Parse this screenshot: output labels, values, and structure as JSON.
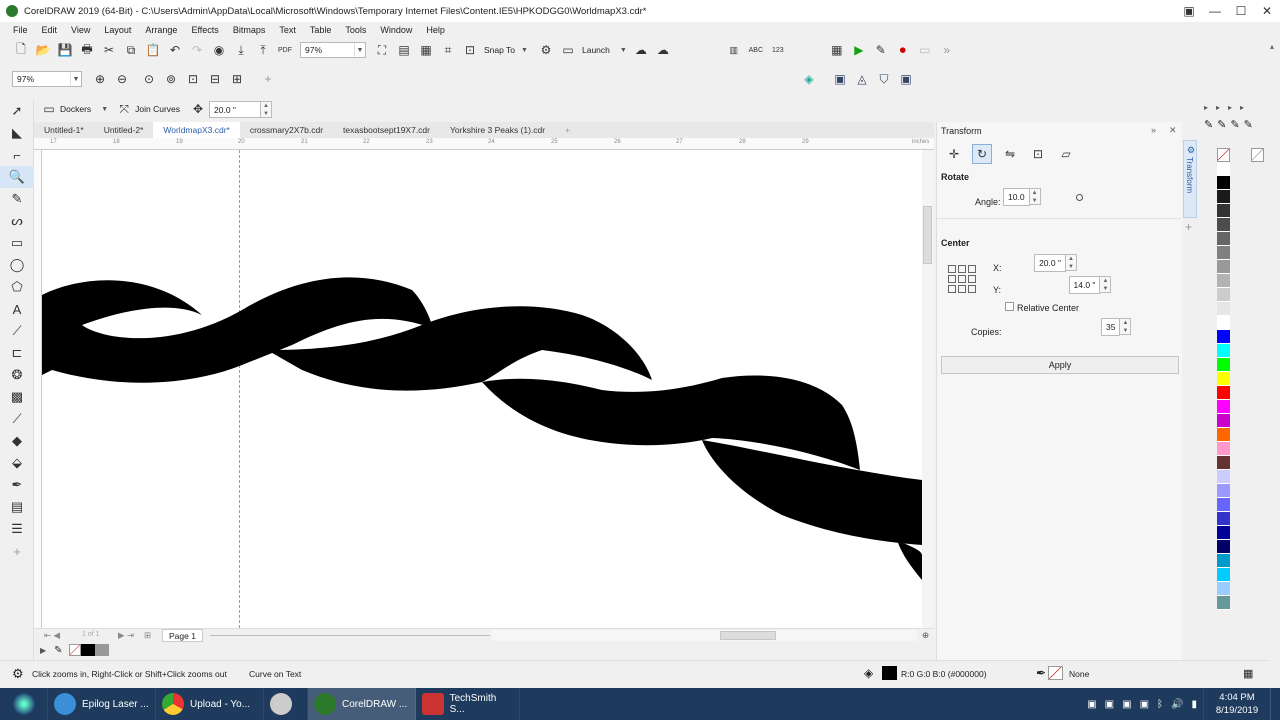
{
  "window": {
    "title": "CorelDRAW 2019 (64-Bit) - C:\\Users\\Admin\\AppData\\Local\\Microsoft\\Windows\\Temporary Internet Files\\Content.IE5\\HPKODGG0\\WorldmapX3.cdr*",
    "minimize": "—",
    "maximize": "☐",
    "close": "✕"
  },
  "menu": [
    "File",
    "Edit",
    "View",
    "Layout",
    "Arrange",
    "Effects",
    "Bitmaps",
    "Text",
    "Table",
    "Tools",
    "Window",
    "Help"
  ],
  "toolbar": {
    "zoom": "97%",
    "snap_to": "Snap To",
    "launch": "Launch"
  },
  "zoombar": {
    "zoom": "97%"
  },
  "propbar": {
    "dockers": "Dockers",
    "join_curves": "Join Curves",
    "distance": "20.0 \""
  },
  "tabs": [
    "Untitled-1*",
    "Untitled-2*",
    "WorldmapX3.cdr*",
    "crossmary2X7b.cdr",
    "texasbootsept19X7.cdr",
    "Yorkshire 3 Peaks (1).cdr"
  ],
  "active_tab": "WorldmapX3.cdr*",
  "ruler": {
    "ticks": [
      "17",
      "18",
      "19",
      "20",
      "21",
      "22",
      "23",
      "24",
      "25",
      "26",
      "27",
      "28",
      "29"
    ],
    "unit": "inches"
  },
  "pagebar": {
    "page_of": "1 of 1",
    "page_label": "Page 1"
  },
  "status": {
    "hint": "Click zooms in, Right-Click or Shift+Click zooms out",
    "object": "Curve on Text",
    "fill": "R:0 G:0 B:0 (#000000)",
    "outline": "None"
  },
  "docker": {
    "title": "Transform",
    "tab_label": "Transform",
    "rotate_heading": "Rotate",
    "angle_label": "Angle:",
    "angle_value": "10.0",
    "center_heading": "Center",
    "x_label": "X:",
    "x_value": "20.0 \"",
    "y_label": "Y:",
    "y_value": "14.0 \"",
    "relative_center": "Relative Center",
    "copies_label": "Copies:",
    "copies_value": "35",
    "apply": "Apply"
  },
  "palette": [
    "#ffffff",
    "#000000",
    "#1a1a1a",
    "#333333",
    "#4d4d4d",
    "#666666",
    "#808080",
    "#999999",
    "#b3b3b3",
    "#cccccc",
    "#e6e6e6",
    "#ffffff",
    "#0000ff",
    "#00ffff",
    "#00ff00",
    "#ffff00",
    "#ff0000",
    "#ff00ff",
    "#cc00cc",
    "#ff6600",
    "#ff99cc",
    "#663333",
    "#ccccff",
    "#9999ff",
    "#6666ff",
    "#3333cc",
    "#000099",
    "#000066",
    "#0099cc",
    "#00ccff",
    "#99ccff",
    "#669999"
  ],
  "taskbar": {
    "items": [
      "Epilog Laser ...",
      "Upload - Yo...",
      "CorelDRAW ...",
      "TechSmith S..."
    ],
    "time": "4:04 PM",
    "date": "8/19/2019"
  }
}
